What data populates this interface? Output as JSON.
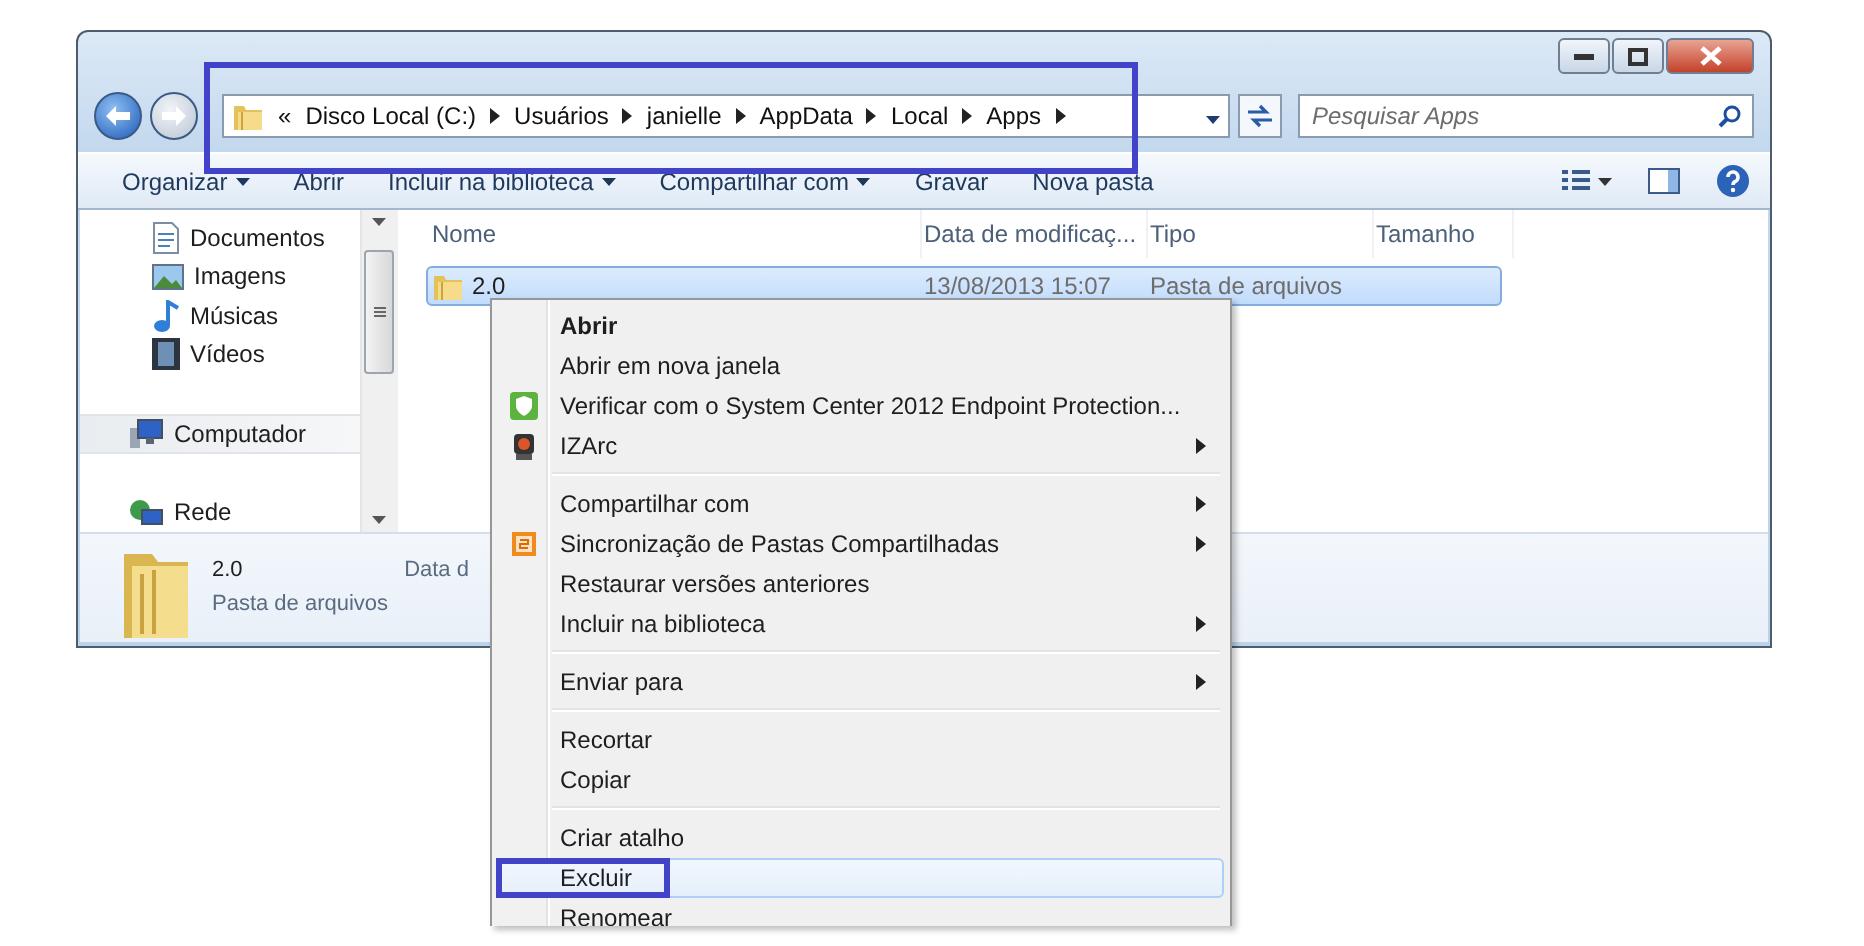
{
  "address_bar": {
    "overflow": "«",
    "crumbs": [
      "Disco Local (C:)",
      "Usuários",
      "janielle",
      "AppData",
      "Local",
      "Apps"
    ]
  },
  "search": {
    "placeholder": "Pesquisar Apps"
  },
  "toolbar": {
    "items": [
      {
        "label": "Organizar",
        "dropdown": true
      },
      {
        "label": "Abrir",
        "dropdown": false
      },
      {
        "label": "Incluir na biblioteca",
        "dropdown": true
      },
      {
        "label": "Compartilhar com",
        "dropdown": true
      },
      {
        "label": "Gravar",
        "dropdown": false
      },
      {
        "label": "Nova pasta",
        "dropdown": false
      }
    ]
  },
  "navigation": {
    "items": [
      {
        "label": "Documentos",
        "kind": "document",
        "selected": false
      },
      {
        "label": "Imagens",
        "kind": "image",
        "selected": false
      },
      {
        "label": "Músicas",
        "kind": "music",
        "selected": false
      },
      {
        "label": "Vídeos",
        "kind": "video",
        "selected": false
      },
      {
        "label": "Computador",
        "kind": "computer",
        "selected": true
      },
      {
        "label": "Rede",
        "kind": "network",
        "selected": false
      }
    ]
  },
  "file_list": {
    "columns": [
      "Nome",
      "Data de modificaç...",
      "Tipo",
      "Tamanho"
    ],
    "rows": [
      {
        "name": "2.0",
        "modified": "13/08/2013 15:07",
        "type": "Pasta de arquivos",
        "selected": true
      }
    ]
  },
  "details": {
    "name": "2.0",
    "type": "Pasta de arquivos",
    "field_label": "Data d"
  },
  "context_menu": {
    "items": [
      {
        "kind": "plain",
        "label": "Abrir",
        "bold": true,
        "submenu": false,
        "selected": false
      },
      {
        "kind": "plain",
        "label": "Abrir em nova janela",
        "bold": false,
        "submenu": false,
        "selected": false
      },
      {
        "kind": "shield",
        "label": "Verificar com o System Center 2012 Endpoint Protection...",
        "bold": false,
        "submenu": false,
        "selected": false
      },
      {
        "kind": "archive",
        "label": "IZArc",
        "bold": false,
        "submenu": true,
        "selected": false
      },
      {
        "kind": "separator"
      },
      {
        "kind": "plain",
        "label": "Compartilhar com",
        "bold": false,
        "submenu": true,
        "selected": false
      },
      {
        "kind": "sync",
        "label": "Sincronização de Pastas Compartilhadas",
        "bold": false,
        "submenu": true,
        "selected": false
      },
      {
        "kind": "plain",
        "label": "Restaurar versões anteriores",
        "bold": false,
        "submenu": false,
        "selected": false
      },
      {
        "kind": "plain",
        "label": "Incluir na biblioteca",
        "bold": false,
        "submenu": true,
        "selected": false
      },
      {
        "kind": "separator"
      },
      {
        "kind": "plain",
        "label": "Enviar para",
        "bold": false,
        "submenu": true,
        "selected": false
      },
      {
        "kind": "separator"
      },
      {
        "kind": "plain",
        "label": "Recortar",
        "bold": false,
        "submenu": false,
        "selected": false
      },
      {
        "kind": "plain",
        "label": "Copiar",
        "bold": false,
        "submenu": false,
        "selected": false
      },
      {
        "kind": "separator"
      },
      {
        "kind": "plain",
        "label": "Criar atalho",
        "bold": false,
        "submenu": false,
        "selected": false
      },
      {
        "kind": "plain",
        "label": "Excluir",
        "bold": false,
        "submenu": false,
        "selected": true
      },
      {
        "kind": "plain",
        "label": "Renomear",
        "bold": false,
        "submenu": false,
        "selected": false
      }
    ]
  }
}
